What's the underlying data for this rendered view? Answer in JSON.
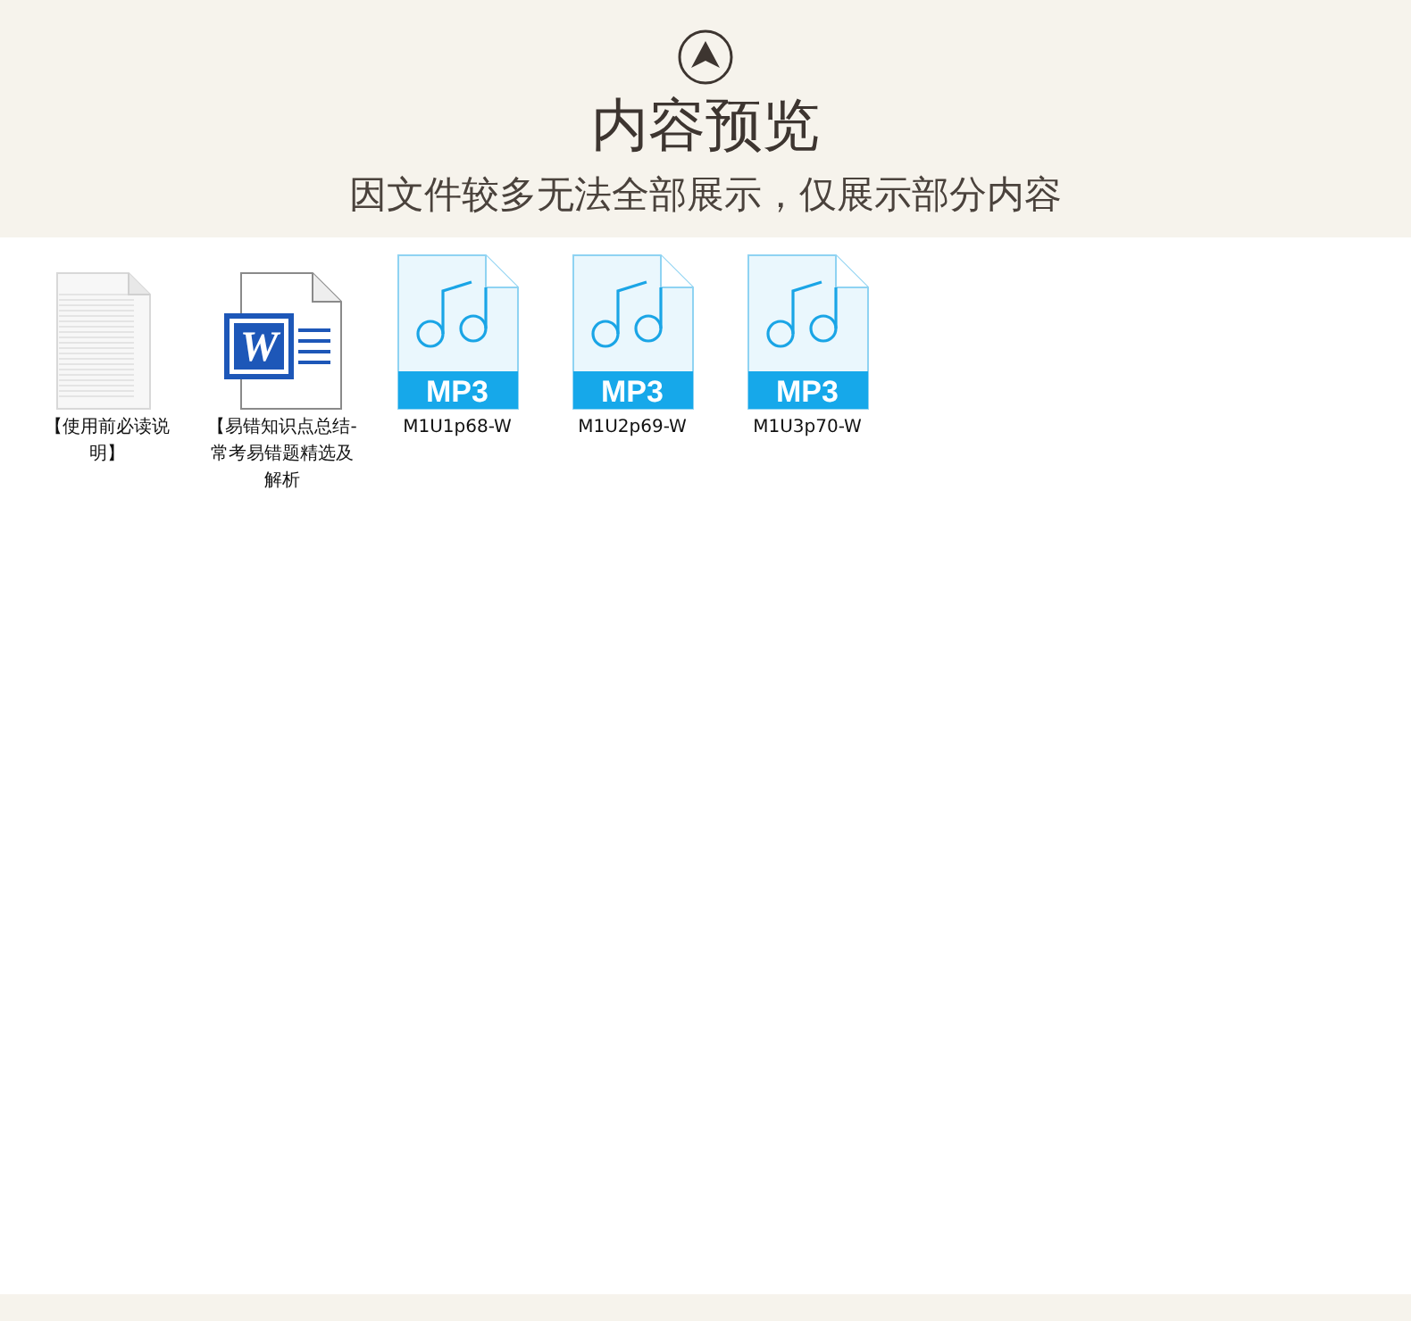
{
  "header": {
    "title": "内容预览",
    "subtitle": "因文件较多无法全部展示，仅展示部分内容"
  },
  "files": [
    {
      "kind": "text",
      "name": "【使用前必读说明】"
    },
    {
      "kind": "word",
      "name": "【易错知识点总结-常考易错题精选及解析",
      "logo_letter": "W"
    },
    {
      "kind": "mp3",
      "name": "M1U1p68-W",
      "badge": "MP3"
    },
    {
      "kind": "mp3",
      "name": "M1U2p69-W",
      "badge": "MP3"
    },
    {
      "kind": "mp3",
      "name": "M1U3p70-W",
      "badge": "MP3"
    }
  ]
}
